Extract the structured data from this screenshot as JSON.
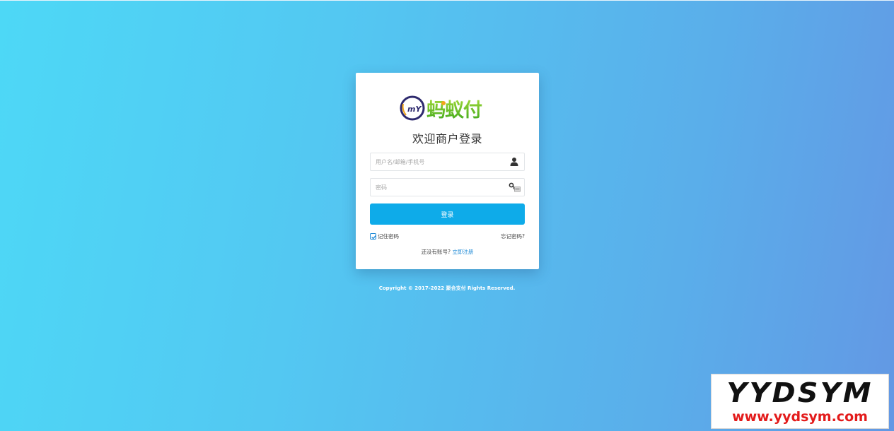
{
  "brand": {
    "logo_text": "mY",
    "logo_name": "蚂蚁付"
  },
  "login": {
    "title": "欢迎商户登录",
    "username_placeholder": "用户名/邮箱/手机号",
    "username_value": "",
    "password_placeholder": "密码",
    "password_value": "",
    "submit_label": "登录",
    "remember_label": "记住密码",
    "remember_checked": true,
    "forgot_label": "忘记密码?",
    "register_prompt": "还没有账号?",
    "register_link": "立即注册"
  },
  "footer": {
    "copyright": "Copyright © 2017-2022 聚合支付 Rights Reserved."
  },
  "watermark": {
    "title": "YYDSYM",
    "url": "www.yydsym.com"
  },
  "icons": {
    "username": "user-icon",
    "password": "key-icon"
  },
  "colors": {
    "bg_start": "#4dd8f6",
    "bg_end": "#6398e4",
    "primary": "#0eabe9",
    "link": "#1c89d6",
    "logo_green": "#6cc21b",
    "logo_navy": "#2e2a6e"
  }
}
